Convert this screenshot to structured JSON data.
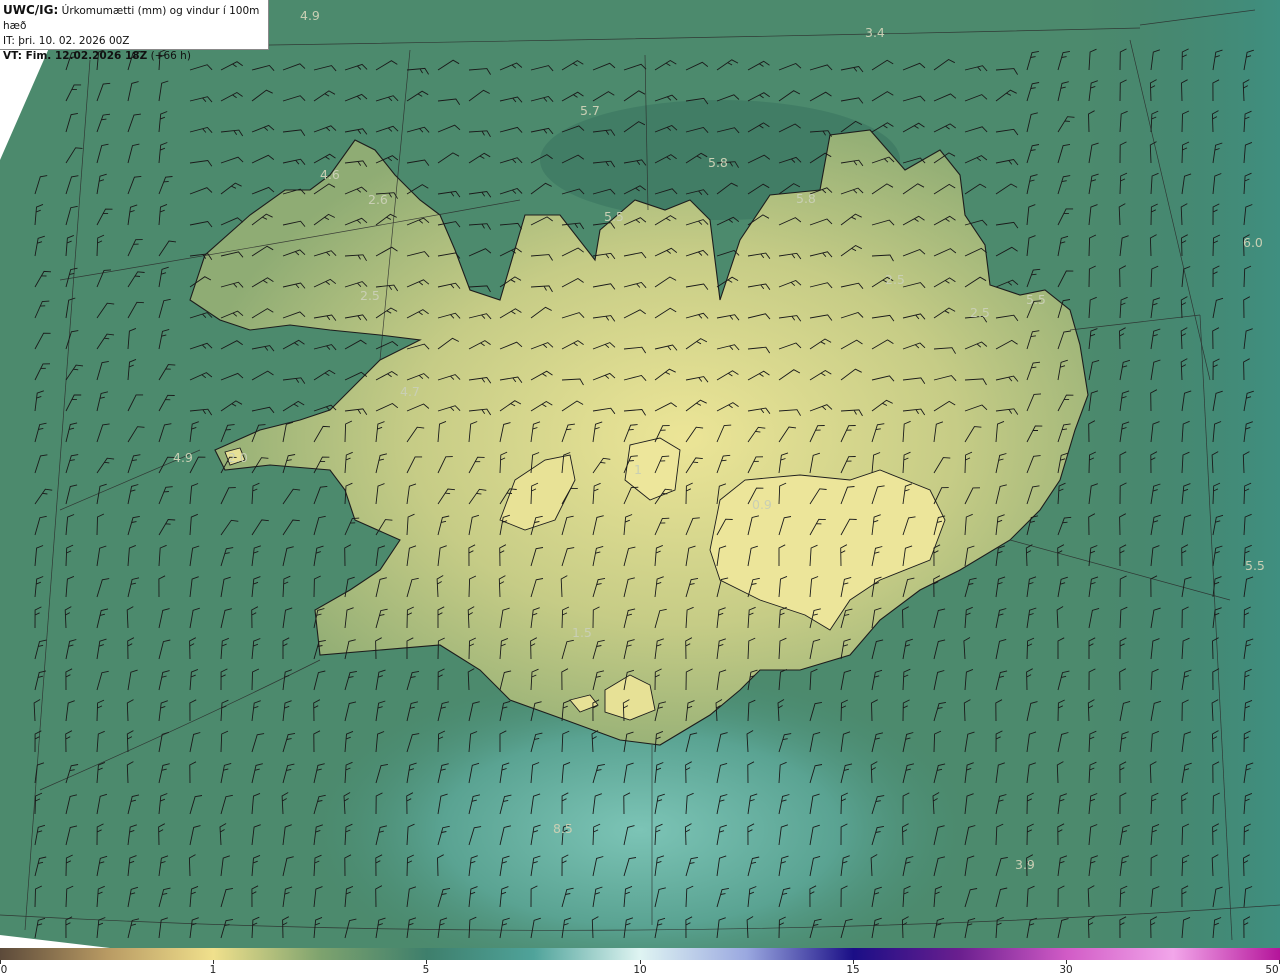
{
  "header": {
    "line1_bold": "UWC/IG:",
    "line1_rest": "Úrkomumætti (mm) og vindur í 100m hæð",
    "line2": "IT: þri. 10. 02. 2026 00Z",
    "line3_bold": "VT: Fim. 12.02.2026 18Z",
    "line3_rest": "(+66 h)"
  },
  "colorbar": {
    "ticks": [
      {
        "label": "0",
        "value": 0
      },
      {
        "label": "1",
        "value": 1
      },
      {
        "label": "5",
        "value": 5
      },
      {
        "label": "10",
        "value": 10
      },
      {
        "label": "15",
        "value": 15
      },
      {
        "label": "30",
        "value": 30
      },
      {
        "label": "50",
        "value": 50
      }
    ],
    "colors": [
      "#5c4a3a",
      "#b89a63",
      "#f0e08c",
      "#7ea36e",
      "#3e7f6c",
      "#4fa39a",
      "#dff4f2",
      "#9aa8e0",
      "#1a0e86",
      "#6b1f8f",
      "#d15bc6",
      "#f2a6ea",
      "#b4149a"
    ]
  },
  "map_labels": [
    "4.9",
    "3.4",
    "5.7",
    "5.8",
    "5.8",
    "4.6",
    "2.6",
    "5.5",
    "2.5",
    "2.5",
    "5.5",
    "6.0",
    "2.5",
    "4.7",
    "4.9",
    "2.0",
    "1",
    "0.9",
    "5.5",
    "1.5",
    "8.5",
    "3.9"
  ],
  "colors": {
    "sea_dark": "#2f6f63",
    "sea_mid": "#4d8a6c",
    "land_mid": "#a9bd7f",
    "land_light": "#e3df95",
    "sea_light": "#6fb8a8",
    "coast": "#1d1d1d",
    "barbs": "#1a1a1a"
  }
}
